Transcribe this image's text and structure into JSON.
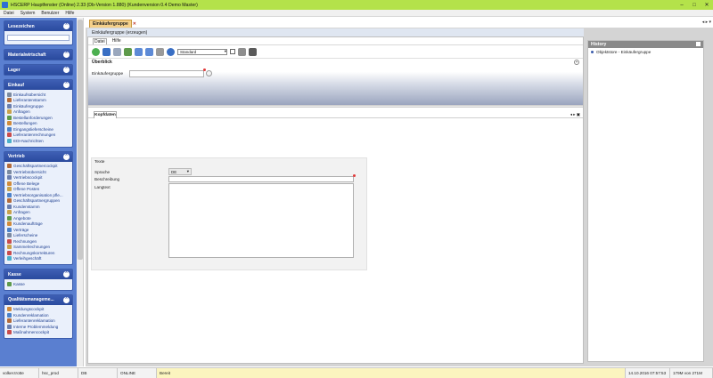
{
  "window": {
    "title": "HSCERP Hauptfenster (Online) 2.33 (Db-Version 1.880) (Kundenversion 0.4 Demo Master)",
    "controls": [
      "–",
      "□",
      "✕"
    ]
  },
  "menubar": [
    "Datei",
    "System",
    "Benutzer",
    "Hilfe"
  ],
  "sidebar": {
    "panels": [
      {
        "title": "Lesezeichen",
        "search": true,
        "items": []
      },
      {
        "title": "Materialwirtschaft",
        "items": []
      },
      {
        "title": "Lager",
        "items": []
      },
      {
        "title": "Einkauf",
        "items": [
          {
            "label": "Einkaufsübersicht",
            "color": "#7b8aa0"
          },
          {
            "label": "Lieferantenstamm",
            "color": "#b36b3a"
          },
          {
            "label": "Einkäufergruppe",
            "color": "#6b7fae"
          },
          {
            "label": "Anfragen",
            "color": "#c9a24c"
          },
          {
            "label": "Bestellanforderungen",
            "color": "#5e9a4b"
          },
          {
            "label": "Bestellungen",
            "color": "#d18b3a"
          },
          {
            "label": "Eingangslieferscheine",
            "color": "#4c82c9"
          },
          {
            "label": "Lieferantenrechnungen",
            "color": "#c94c4c"
          },
          {
            "label": "EDI-Nachrichten",
            "color": "#4cb0c9"
          }
        ]
      },
      {
        "title": "Vertrieb",
        "items": [
          {
            "label": "Geschäftspartnercockpit",
            "color": "#b36b3a"
          },
          {
            "label": "Vertriebsübersicht",
            "color": "#7b8aa0"
          },
          {
            "label": "Vertriebscockpit",
            "color": "#6b7fae"
          },
          {
            "label": "Offene Belege",
            "color": "#d18b3a"
          },
          {
            "label": "Offene Posten",
            "color": "#c9a24c"
          },
          {
            "label": "Vertriebsorganisation pfle...",
            "color": "#4c82c9"
          },
          {
            "label": "Geschäftspartnergruppen",
            "color": "#b36b3a"
          },
          {
            "label": "Kundenstamm",
            "color": "#6b7fae"
          },
          {
            "label": "Anfragen",
            "color": "#c9a24c"
          },
          {
            "label": "Angebote",
            "color": "#5e9a4b"
          },
          {
            "label": "Kundenaufträge",
            "color": "#d18b3a"
          },
          {
            "label": "Verträge",
            "color": "#4c82c9"
          },
          {
            "label": "Lieferscheine",
            "color": "#7b8aa0"
          },
          {
            "label": "Rechnungen",
            "color": "#c94c4c"
          },
          {
            "label": "Sammelrechnungen",
            "color": "#c9a24c"
          },
          {
            "label": "Rechnungskorrekturen",
            "color": "#c94c4c"
          },
          {
            "label": "Verleihgeschäft",
            "color": "#4cb0c9"
          }
        ]
      },
      {
        "title": "Kasse",
        "items": [
          {
            "label": "Kasse",
            "color": "#5e9a4b"
          }
        ]
      },
      {
        "title": "Qualitätsmanageme...",
        "items": [
          {
            "label": "Meldungscockpit",
            "color": "#d18b3a"
          },
          {
            "label": "Kundenreklamation",
            "color": "#4c82c9"
          },
          {
            "label": "Lieferantenreklamation",
            "color": "#b36b3a"
          },
          {
            "label": "Interne Problemmeldung",
            "color": "#6b7fae"
          },
          {
            "label": "Maßnahmencockpit",
            "color": "#c94c4c"
          }
        ]
      }
    ]
  },
  "tabs": {
    "active": "Einkäufergruppe",
    "close": "✕",
    "nav": "◂ ▸ ▾"
  },
  "document": {
    "header": "Einkäufergruppe (erzeugen)",
    "menu": [
      "Datei",
      "Hilfe"
    ],
    "toolbar": {
      "buttons": [
        {
          "name": "new-icon",
          "color": "#4caf50",
          "round": true
        },
        {
          "name": "save-icon",
          "color": "#3a6fc4"
        },
        {
          "name": "copy-icon",
          "color": "#9aa7bd"
        },
        {
          "name": "refresh-icon",
          "color": "#5e9a4b"
        },
        {
          "name": "undo-icon",
          "color": "#5d8ad6"
        },
        {
          "name": "redo-icon",
          "color": "#5d8ad6"
        },
        {
          "name": "delete-icon",
          "color": "#9a9a9a"
        },
        {
          "name": "info-icon",
          "color": "#3a6fc4",
          "round": true
        }
      ],
      "layout_select": "Standard",
      "layout_arrow": "▾"
    },
    "overview": {
      "title": "Überblick",
      "collapse": "⌃",
      "field_label": "Einkäufergruppe",
      "field_value": ""
    },
    "subtabs": {
      "active": "Kopfdaten",
      "controls": "◂ ▸ ▣"
    },
    "texte": {
      "title": "Texte",
      "sprache_label": "Sprache",
      "sprache_value": "DE",
      "sprache_arrow": "▾",
      "beschreibung_label": "Beschreibung",
      "beschreibung_value": "",
      "langtext_label": "Langtext",
      "langtext_value": ""
    }
  },
  "history": {
    "title": "History",
    "items": [
      "Objektstore - Einkäufergruppe"
    ]
  },
  "statusbar": {
    "user": "volker.trotte",
    "db": "hsc_prod",
    "env": "DB",
    "mode": "ONLINE",
    "status": "Bereit",
    "datetime": "14.10.2016 07:57:53",
    "memory": "179M von 271M"
  }
}
